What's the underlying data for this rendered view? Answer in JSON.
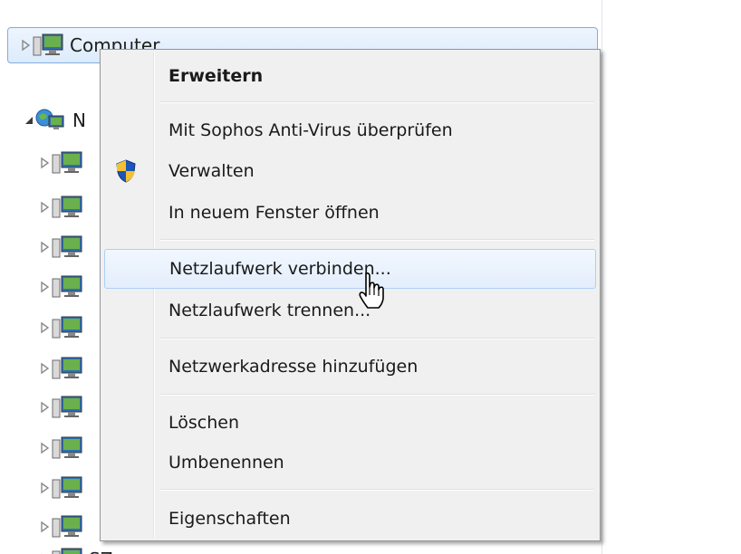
{
  "tree": {
    "computer_label": "Computer",
    "network_label": "N",
    "partial_labels": [
      "",
      "",
      "",
      "",
      "",
      "",
      "",
      "",
      "",
      "",
      "SZ"
    ]
  },
  "context_menu": {
    "items": [
      {
        "label": "Erweitern",
        "default": true
      },
      {
        "label": "Mit Sophos Anti-Virus überprüfen"
      },
      {
        "label": "Verwalten",
        "icon": "uac-shield-icon"
      },
      {
        "label": "In neuem Fenster öffnen"
      },
      {
        "label": "Netzlaufwerk verbinden...",
        "hover": true
      },
      {
        "label": "Netzlaufwerk trennen..."
      },
      {
        "label": "Netzwerkadresse hinzufügen"
      },
      {
        "label": "Löschen"
      },
      {
        "label": "Umbenennen"
      },
      {
        "label": "Eigenschaften"
      }
    ]
  },
  "colors": {
    "selection_border": "#84acdd",
    "menu_background": "#f0f0f0",
    "hover_border": "#aecff7"
  }
}
